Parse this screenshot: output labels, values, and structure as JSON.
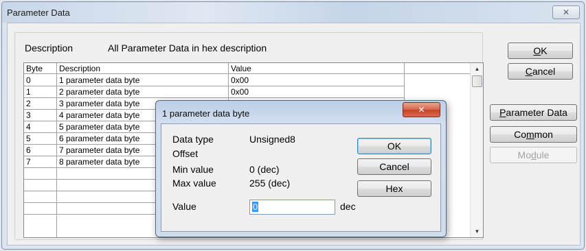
{
  "window": {
    "title": "Parameter Data",
    "close_glyph": "✕"
  },
  "description": {
    "label": "Description",
    "value": "All Parameter Data in hex description"
  },
  "table": {
    "headers": {
      "byte": "Byte",
      "description": "Description",
      "value": "Value"
    },
    "rows": [
      {
        "byte": "0",
        "description": "1 parameter data byte",
        "value": "0x00"
      },
      {
        "byte": "1",
        "description": "2 parameter data byte",
        "value": "0x00"
      },
      {
        "byte": "2",
        "description": "3 parameter data byte",
        "value": ""
      },
      {
        "byte": "3",
        "description": "4 parameter data byte",
        "value": ""
      },
      {
        "byte": "4",
        "description": "5 parameter data byte",
        "value": ""
      },
      {
        "byte": "5",
        "description": "6 parameter data byte",
        "value": ""
      },
      {
        "byte": "6",
        "description": "7 parameter data byte",
        "value": ""
      },
      {
        "byte": "7",
        "description": "8 parameter data byte",
        "value": ""
      }
    ]
  },
  "buttons": {
    "ok": {
      "accel": "O",
      "rest": "K"
    },
    "cancel": {
      "accel": "C",
      "rest": "ancel"
    },
    "parameter_data": {
      "accel": "P",
      "rest": "arameter Data"
    },
    "common": {
      "pre": "Co",
      "accel": "m",
      "post": "mon"
    },
    "module": {
      "pre": "Mo",
      "accel": "d",
      "post": "ule"
    }
  },
  "modal": {
    "title": "1 parameter data byte",
    "close_glyph": "✕",
    "data_type_label": "Data type",
    "data_type_value": "Unsigned8",
    "offset_label": "Offset",
    "min_label": "Min value",
    "min_value": "0 (dec)",
    "max_label": "Max value",
    "max_value": "255 (dec)",
    "value_label": "Value",
    "value_input": "0",
    "value_unit": "dec",
    "ok_label": "OK",
    "cancel_label": "Cancel",
    "hex_label": "Hex"
  }
}
